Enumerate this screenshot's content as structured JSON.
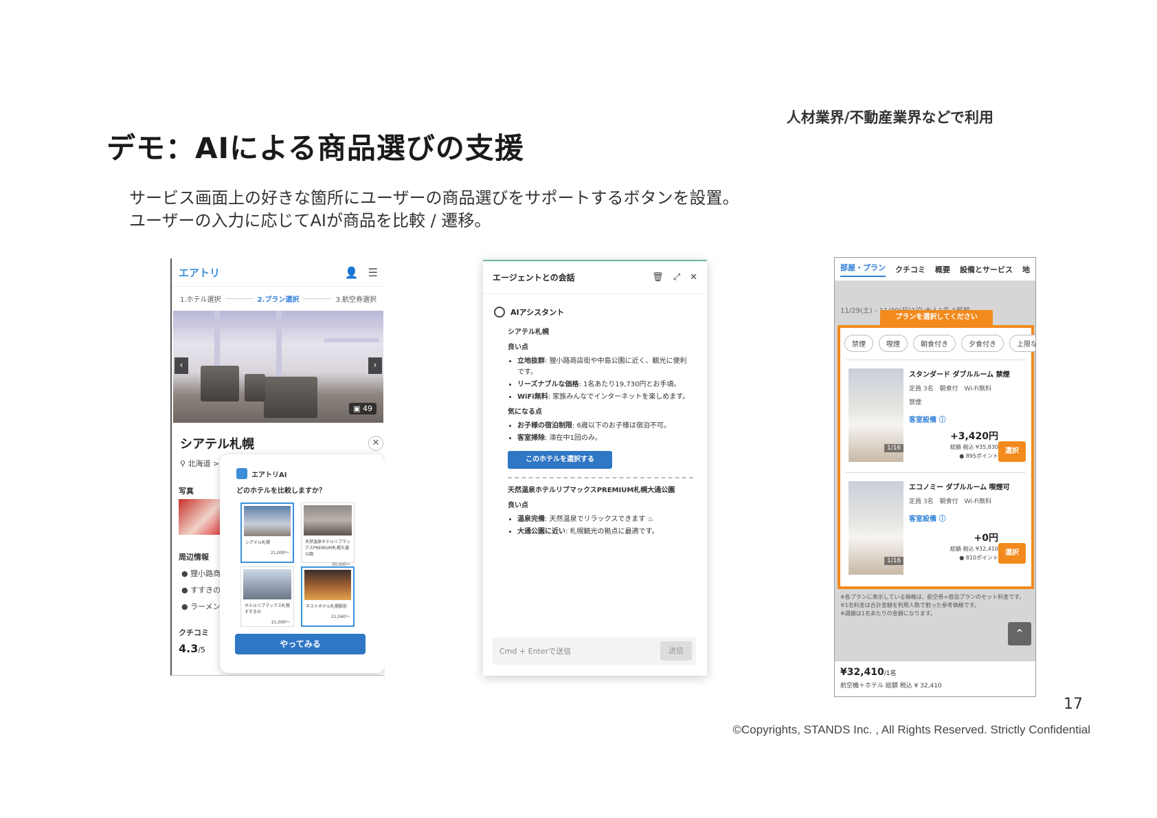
{
  "slide": {
    "tagline": "人材業界/不動産業界などで利用",
    "title": "デモ：AIによる商品選びの支援",
    "description": [
      "サービス画面上の好きな箇所にユーザーの商品選びをサポートするボタンを設置。",
      "ユーザーの入力に応じてAIが商品を比較 / 遷移。"
    ],
    "page_number": "17",
    "copyright": "©Copyrights, STANDS Inc. , All Rights Reserved. Strictly Confidential"
  },
  "hotel_page": {
    "logo": "エアトリ",
    "steps": [
      "1.ホテル選択",
      "2.プラン選択",
      "3.航空券選択"
    ],
    "photo_count": "49",
    "hotel_name": "シアテル札幌",
    "location": "北海道 >",
    "sections": {
      "photos": "写真",
      "nearby": "周辺情報",
      "reviews": "クチコミ"
    },
    "nearby": [
      "狸小路商",
      "すすきの",
      "ラーメン"
    ],
    "rating": "4.3",
    "rating_scale": "/5",
    "popup": {
      "brand": "エアトリAI",
      "question": "どのホテルを比較しますか？",
      "cards": [
        {
          "name": "シアテル札幌",
          "price": "21,000〜"
        },
        {
          "name": "天然温泉ホテルリブマックスPREMIUM札幌大通公園",
          "price": "30,000〜"
        },
        {
          "name": "ホテルリブマックス札幌すすきの",
          "price": "21,000〜"
        },
        {
          "name": "ネストホテル札幌駅前",
          "price": "21,040〜"
        }
      ],
      "button": "やってみる"
    }
  },
  "chat": {
    "title": "エージェントとの会話",
    "assistant": "AIアシスタント",
    "hotel1": {
      "name": "シアテル札幌",
      "good_title": "良い点",
      "good": [
        {
          "k": "立地抜群",
          "v": ": 狸小路商店街や中島公園に近く、観光に便利です。"
        },
        {
          "k": "リーズナブルな価格",
          "v": ": 1名あたり19,730円とお手頃。"
        },
        {
          "k": "WiFi無料",
          "v": ": 家族みんなでインターネットを楽しめます。"
        }
      ],
      "concern_title": "気になる点",
      "concern": [
        {
          "k": "お子様の宿泊制限",
          "v": ": 6歳以下のお子様は宿泊不可。"
        },
        {
          "k": "客室掃除",
          "v": ": 滞在中1回のみ。"
        }
      ],
      "select_button": "このホテルを選択する"
    },
    "hotel2": {
      "name": "天然温泉ホテルリブマックスPREMIUM札幌大通公園",
      "good_title": "良い点",
      "good": [
        {
          "k": "温泉完備",
          "v": ": 天然温泉でリラックスできます ♨"
        },
        {
          "k": "大通公園に近い",
          "v": ": 札幌観光の拠点に最適です。"
        }
      ]
    },
    "input_placeholder": "Cmd + Enterで送信",
    "send": "送信"
  },
  "plan_page": {
    "tabs": [
      "部屋・プラン",
      "クチコミ",
      "概要",
      "設備とサービス",
      "地"
    ],
    "date": "11/29(土) - 11/30(日)1泊 大人1名 1部屋",
    "banner": "プランを選択してください",
    "chips": [
      "禁煙",
      "喫煙",
      "朝食付き",
      "夕食付き",
      "上限なし"
    ],
    "rooms": [
      {
        "name": "スタンダード ダブルルーム 禁煙",
        "meta1": "定員 3名　朝食付　Wi-Fi無料",
        "meta2": "禁煙",
        "equipment": "客室設備 ⓘ",
        "price": "+3,420円",
        "total": "総額 税込 ¥35,830",
        "points": "895ポイント",
        "page": "1/16",
        "button": "選択"
      },
      {
        "name": "エコノミー ダブルルーム 喫煙可",
        "meta1": "定員 3名　朝食付　Wi-Fi無料",
        "meta2": "",
        "equipment": "客室設備 ⓘ",
        "price": "+0円",
        "total": "総額 税込 ¥32,410",
        "points": "810ポイント",
        "page": "1/16",
        "button": "選択"
      }
    ],
    "notes": [
      "※各プランに表示している価格は、航空券+宿泊プランのセット料金です。",
      "※1名料金は合計金額を利用人数で割った参考価格です。",
      "※週額は1名あたりの金額になります。"
    ],
    "footer_price": "¥32,410",
    "footer_unit": "/1名",
    "footer_sub": "航空機＋ホテル 総額 税込 ¥ 32,410"
  }
}
